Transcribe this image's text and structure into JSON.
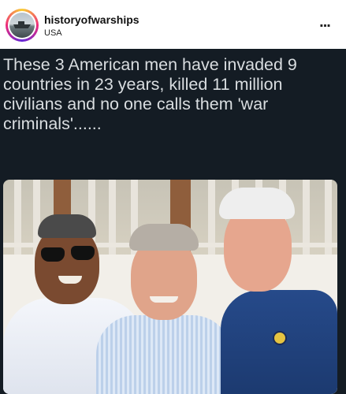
{
  "header": {
    "username": "historyofwarships",
    "location": "USA",
    "more_icon": "ellipsis-icon",
    "more_label": "..."
  },
  "post": {
    "caption": "These 3 American men have invaded 9 countries in 23 years, killed 11 million civilians and no one calls them 'war criminals'......",
    "background_color": "#141c24",
    "caption_color": "#d9dde0",
    "photo_description_icon": "photo-three-men"
  }
}
